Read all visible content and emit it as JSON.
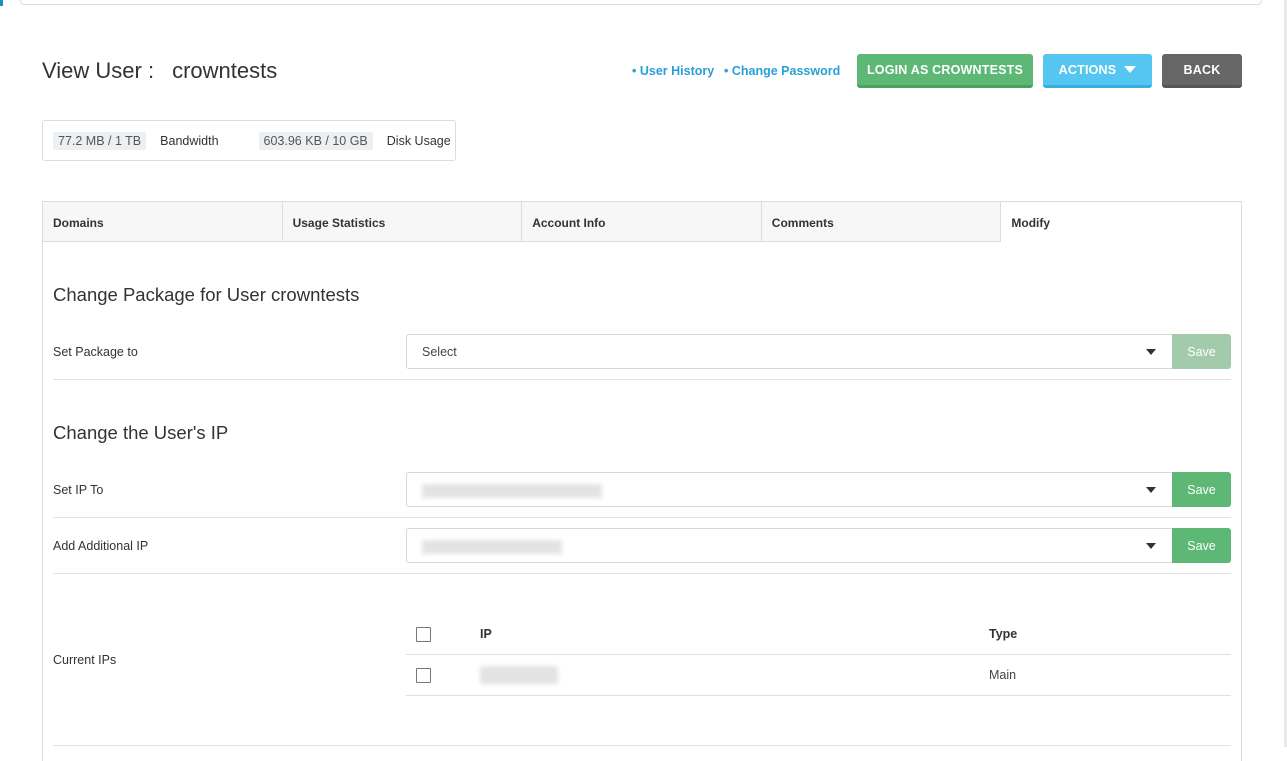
{
  "header": {
    "title_prefix": "View User :",
    "username": "crowntests",
    "links": {
      "user_history": "• User History",
      "change_password": "• Change Password"
    },
    "buttons": {
      "login_as": "LOGIN AS CROWNTESTS",
      "actions": "ACTIONS",
      "back": "BACK"
    }
  },
  "usage": {
    "bandwidth_value": "77.2 MB / 1 TB",
    "bandwidth_label": "Bandwidth",
    "disk_value": "603.96 KB / 10 GB",
    "disk_label": "Disk Usage"
  },
  "tabs": [
    {
      "label": "Domains"
    },
    {
      "label": "Usage Statistics"
    },
    {
      "label": "Account Info"
    },
    {
      "label": "Comments"
    },
    {
      "label": "Modify"
    }
  ],
  "modify": {
    "package_section_title": "Change Package for User crowntests",
    "set_package_label": "Set Package to",
    "package_select_value": "Select",
    "ip_section_title": "Change the User's IP",
    "set_ip_label": "Set IP To",
    "add_ip_label": "Add Additional IP",
    "current_ips_label": "Current IPs",
    "save_label": "Save",
    "ip_table": {
      "headers": {
        "ip": "IP",
        "type": "Type"
      },
      "rows": [
        {
          "type": "Main"
        }
      ]
    }
  },
  "colors": {
    "accent_blue": "#2a9fd6",
    "login_green": "#5cb874",
    "actions_blue": "#54c6f0",
    "back_gray": "#666666",
    "save_disabled": "#a3cbab"
  }
}
